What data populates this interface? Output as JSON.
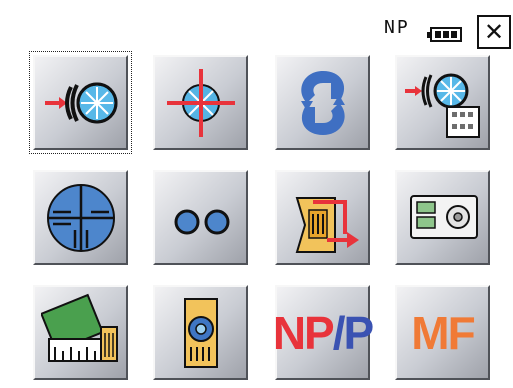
{
  "status_bar": {
    "mode_label": "NP",
    "battery_icon": "battery-icon",
    "close_label": "✕"
  },
  "menu_icons": [
    [
      "edm-measure-icon",
      "target-crosshair-icon",
      "rotation-icon",
      "edm-menu-icon"
    ],
    [
      "reticle-icon",
      "two-dots-icon",
      "stakeout-icon",
      "memory-card-icon"
    ],
    [
      "ppm-correction-icon",
      "prism-icon",
      "np-p-toggle-icon",
      "mf-icon"
    ]
  ],
  "text_tiles": {
    "np_p": {
      "np": "NP",
      "slash": "/",
      "p": "P"
    },
    "mf": "MF"
  },
  "colors": {
    "np_red": "#e8333b",
    "p_blue": "#3a52b2",
    "mf_orange": "#f07a36"
  }
}
